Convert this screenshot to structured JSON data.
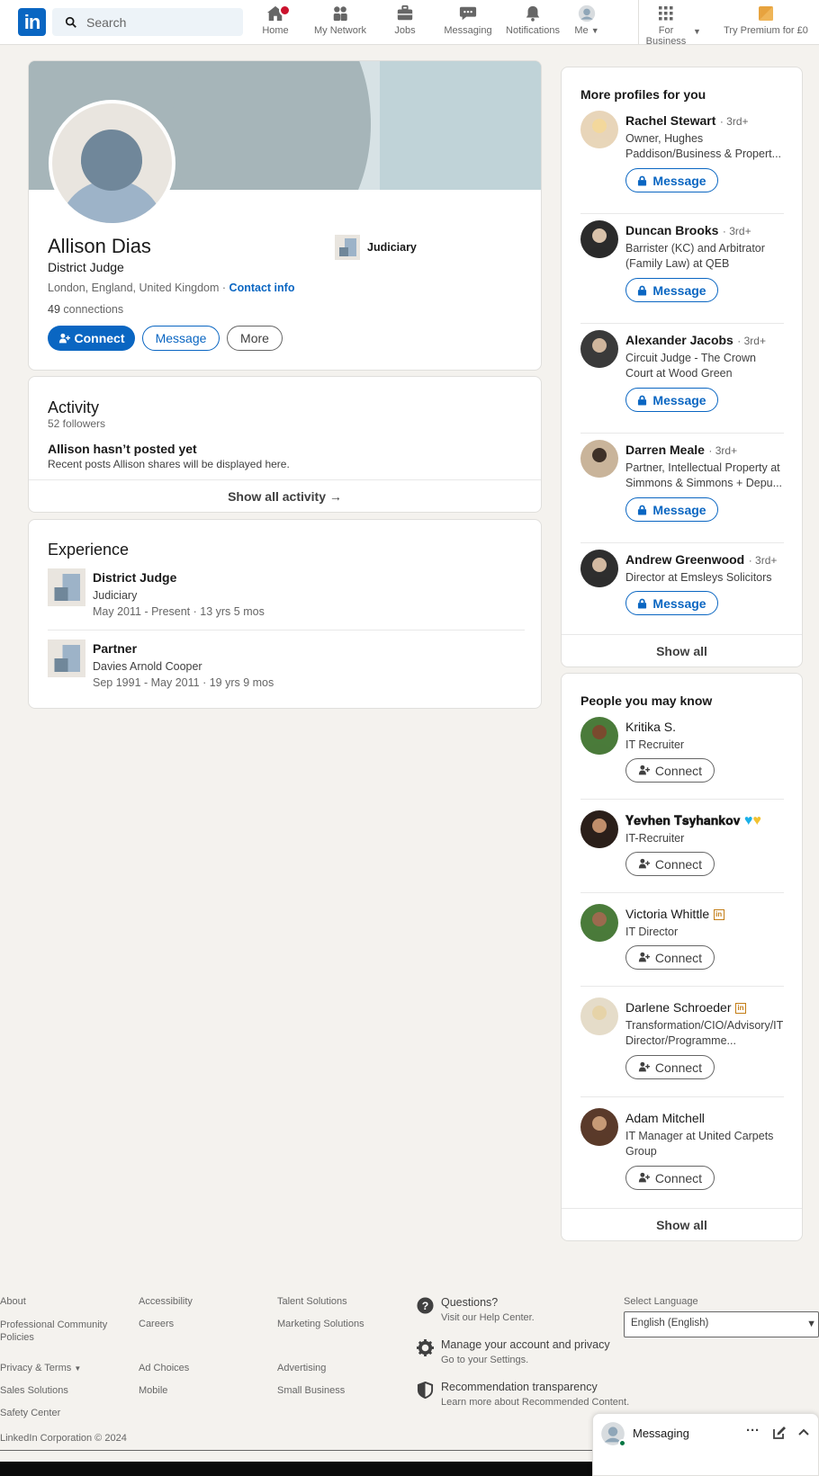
{
  "nav": {
    "search_placeholder": "Search",
    "items": [
      {
        "label": "Home"
      },
      {
        "label": "My Network"
      },
      {
        "label": "Jobs"
      },
      {
        "label": "Messaging"
      },
      {
        "label": "Notifications"
      },
      {
        "label": "Me"
      }
    ],
    "for_business": "For Business",
    "premium": "Try Premium for £0"
  },
  "profile": {
    "name": "Allison Dias",
    "headline": "District Judge",
    "location": "London, England, United Kingdom",
    "contact_info": "Contact info",
    "connections_count": "49",
    "connections_label": "connections",
    "company": "Judiciary",
    "connect_label": "Connect",
    "message_label": "Message",
    "more_label": "More"
  },
  "activity": {
    "title": "Activity",
    "followers": "52 followers",
    "empty_title": "Allison hasn’t posted yet",
    "empty_sub": "Recent posts Allison shares will be displayed here.",
    "show_all": "Show all activity →"
  },
  "experience": {
    "title": "Experience",
    "items": [
      {
        "title": "District Judge",
        "company": "Judiciary",
        "dates": "May 2011 - Present · 13 yrs 5 mos"
      },
      {
        "title": "Partner",
        "company": "Davies Arnold Cooper",
        "dates": "Sep 1991 - May 2011 · 19 yrs 9 mos"
      }
    ]
  },
  "more_profiles": {
    "title": "More profiles for you",
    "items": [
      {
        "name": "Rachel Stewart",
        "degree": "· 3rd+",
        "headline": "Owner, Hughes Paddison/Business & Propert...",
        "action": "Message"
      },
      {
        "name": "Duncan Brooks",
        "degree": "· 3rd+",
        "headline": "Barrister (KC) and Arbitrator (Family Law) at QEB",
        "action": "Message"
      },
      {
        "name": "Alexander Jacobs",
        "degree": "· 3rd+",
        "headline": "Circuit Judge - The Crown Court at Wood Green",
        "action": "Message"
      },
      {
        "name": "Darren Meale",
        "degree": "· 3rd+",
        "headline": "Partner, Intellectual Property at Simmons & Simmons + Depu...",
        "action": "Message"
      },
      {
        "name": "Andrew Greenwood",
        "degree": "· 3rd+",
        "headline": "Director at Emsleys Solicitors",
        "action": "Message"
      }
    ],
    "show_all": "Show all"
  },
  "people_you_may_know": {
    "title": "People you may know",
    "items": [
      {
        "name": "Kritika S.",
        "headline": "IT Recruiter",
        "action": "Connect"
      },
      {
        "name": "𝐘𝐞𝐯𝐡𝐞𝐧 𝐓𝐬𝐲𝐡𝐚𝐧𝐤𝐨𝐯",
        "headline": "IT-Recruiter",
        "action": "Connect"
      },
      {
        "name": "Victoria Whittle",
        "headline": "IT Director",
        "action": "Connect"
      },
      {
        "name": "Darlene Schroeder",
        "headline": "Transformation/CIO/Advisory/IT Director/Programme...",
        "action": "Connect"
      },
      {
        "name": "Adam Mitchell",
        "headline": "IT Manager at United Carpets Group",
        "action": "Connect"
      }
    ],
    "show_all": "Show all"
  },
  "footer": {
    "col1": [
      "About",
      "Professional Community Policies",
      "Privacy & Terms",
      "Sales Solutions",
      "Safety Center"
    ],
    "col2": [
      "Accessibility",
      "Careers",
      "Ad Choices",
      "Mobile"
    ],
    "col3": [
      "Talent Solutions",
      "Marketing Solutions",
      "Advertising",
      "Small Business"
    ],
    "help": [
      {
        "title": "Questions?",
        "sub": "Visit our Help Center."
      },
      {
        "title": "Manage your account and privacy",
        "sub": "Go to your Settings."
      },
      {
        "title": "Recommendation transparency",
        "sub": "Learn more about Recommended Content."
      }
    ],
    "language_label": "Select Language",
    "language_value": "English (English)",
    "copyright": "LinkedIn Corporation © 2024"
  },
  "messaging_bar": {
    "label": "Messaging"
  },
  "colors": {
    "brand": "#0a66c2",
    "premium": "#e7a33e",
    "background": "#f4f2ee"
  }
}
